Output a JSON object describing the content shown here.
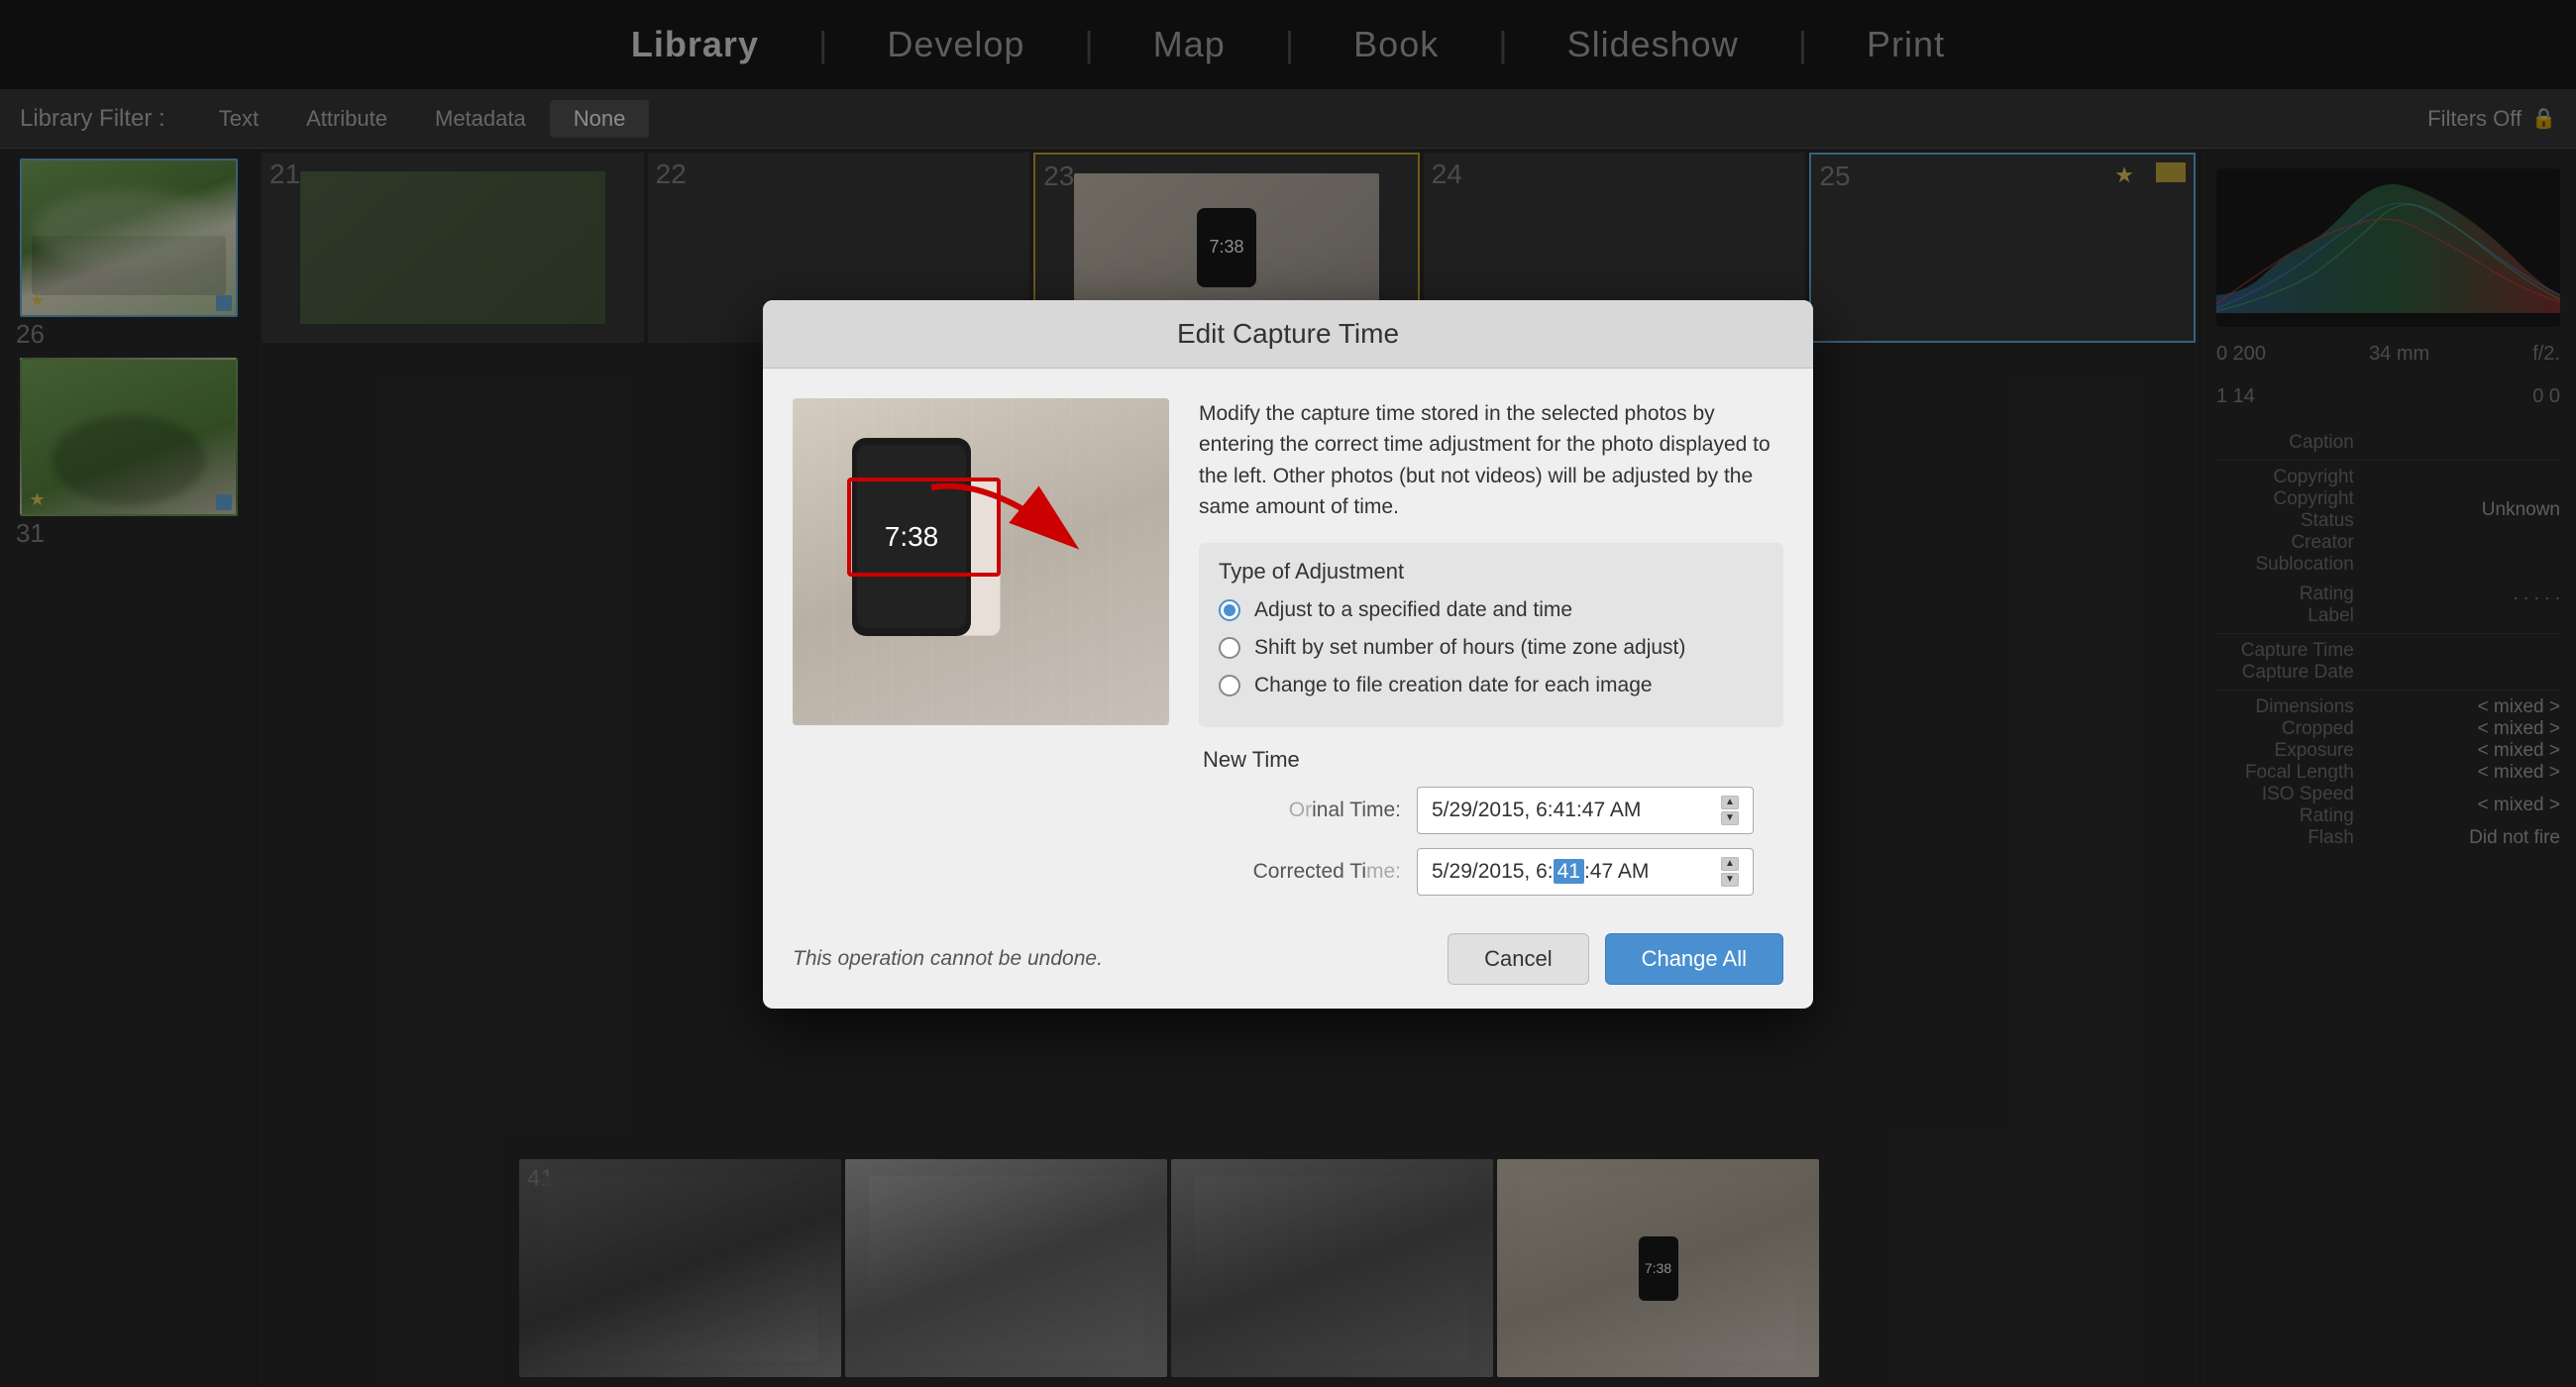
{
  "topNav": {
    "items": [
      "Library",
      "Develop",
      "Map",
      "Book",
      "Slideshow",
      "Print"
    ],
    "active": "Library",
    "divider": "|"
  },
  "filterBar": {
    "label": "Library Filter :",
    "buttons": [
      "Text",
      "Attribute",
      "Metadata",
      "None"
    ],
    "active": "None",
    "filtersOff": "Filters Off"
  },
  "dialog": {
    "title": "Edit Capture Time",
    "description": "Modify the capture time stored in the selected photos by entering the correct time adjustment for the photo displayed to the left. Other photos (but not videos) will be adjusted by the same amount of time.",
    "adjustmentSection": {
      "title": "Type of Adjustment",
      "options": [
        {
          "label": "Adjust to a specified date and time",
          "checked": true
        },
        {
          "label": "Shift by set number of hours (time zone adjust)",
          "checked": false
        },
        {
          "label": "Change to file creation date for each image",
          "checked": false
        }
      ]
    },
    "newTimeSection": {
      "title": "New Time",
      "originalLabel": "inal Time:",
      "originalValue": "5/29/2015,  6:41:47 AM",
      "correctedLabel": "Corrected Ti",
      "correctedValue1": "5/29/2015,  6:",
      "correctedHighlight": "41",
      "correctedValue2": ":47 AM"
    },
    "footer": {
      "warning": "This operation cannot be undone.",
      "cancelLabel": "Cancel",
      "changeAllLabel": "Change All"
    }
  },
  "rightPanel": {
    "stats": [
      {
        "label": "0 200",
        "value": "34 mm"
      },
      {
        "label": "f/2.",
        "value": ""
      },
      {
        "label": "1 14",
        "value": "0    0"
      }
    ],
    "fields": [
      {
        "label": "Caption",
        "value": ""
      },
      {
        "label": "Copyright",
        "value": ""
      },
      {
        "label": "Copyright Status",
        "value": "Unknown"
      },
      {
        "label": "Creator",
        "value": ""
      },
      {
        "label": "Sublocation",
        "value": ""
      },
      {
        "label": "Rating",
        "value": ". . . . ."
      },
      {
        "label": "Label",
        "value": ""
      },
      {
        "label": "Capture Time",
        "value": ""
      },
      {
        "label": "Capture Date",
        "value": ""
      },
      {
        "label": "Dimensions",
        "value": "< mixed >"
      },
      {
        "label": "Cropped",
        "value": "< mixed >"
      },
      {
        "label": "Exposure",
        "value": "< mixed >"
      },
      {
        "label": "Focal Length",
        "value": "< mixed >"
      },
      {
        "label": "ISO Speed Rating",
        "value": "< mixed >"
      },
      {
        "label": "Flash",
        "value": "Did not fire"
      }
    ]
  },
  "gridCells": [
    {
      "num": "21"
    },
    {
      "num": "22"
    },
    {
      "num": "23",
      "hasThumb": true
    },
    {
      "num": "24"
    },
    {
      "num": "25",
      "hasStar": true,
      "hasFlag": true
    }
  ],
  "bottomThumbs": [
    {
      "num": "41"
    },
    {
      "num": ""
    },
    {
      "num": ""
    },
    {
      "num": ""
    }
  ],
  "leftThumbs": [
    {
      "num": "26",
      "hasStar": true
    },
    {
      "num": "31",
      "hasStar": true
    }
  ]
}
